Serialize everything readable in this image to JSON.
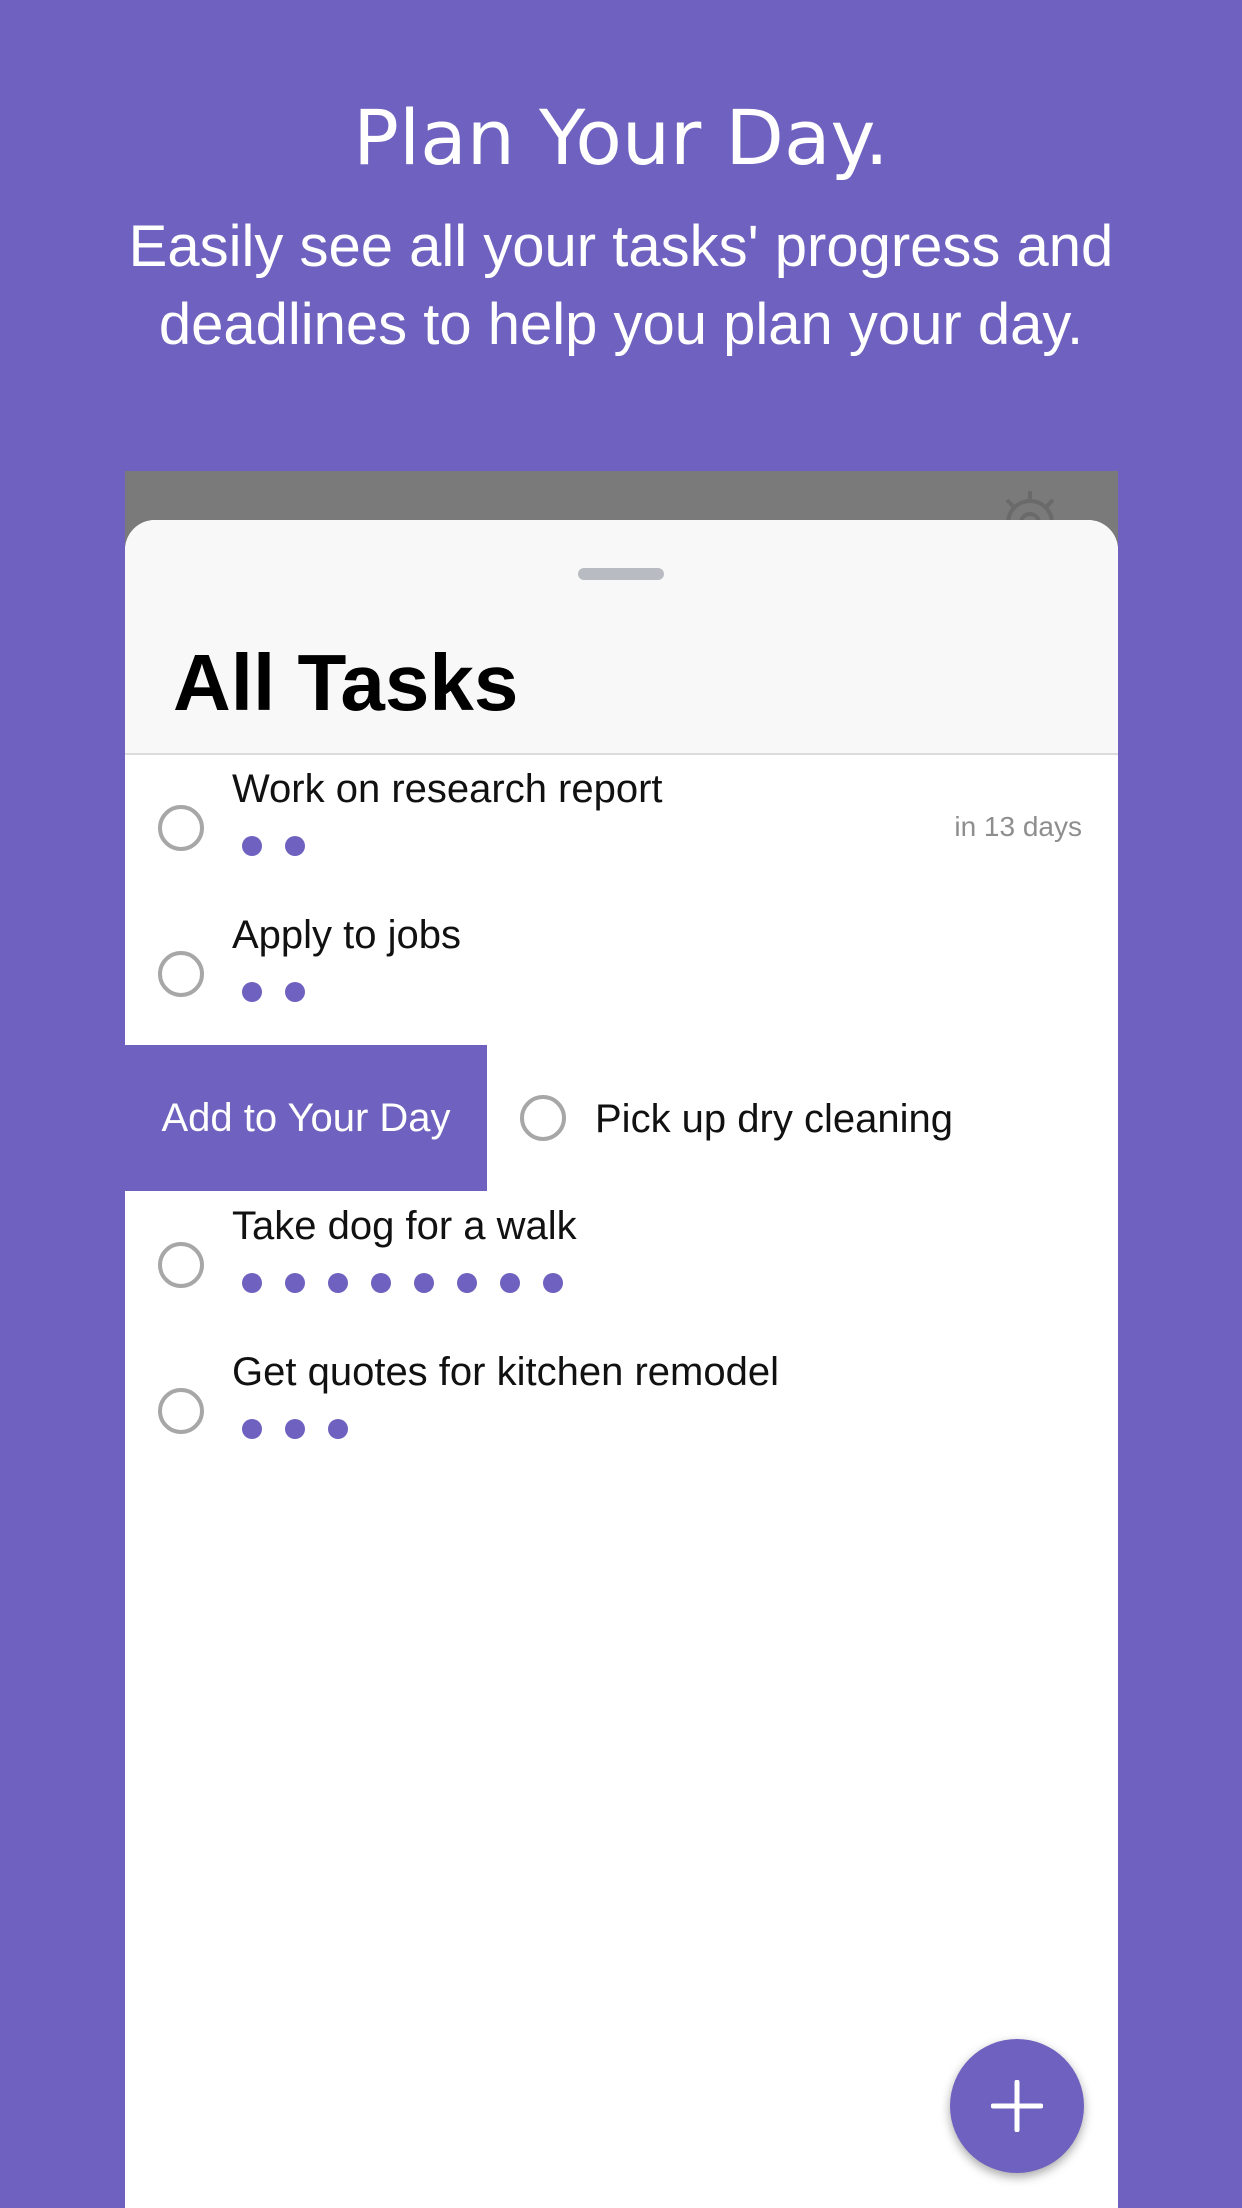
{
  "hero": {
    "title": "Plan Your Day.",
    "subtitle_line1": "Easily see all your tasks' progress and",
    "subtitle_line2": "deadlines to help you plan your day."
  },
  "sheet": {
    "title": "All Tasks"
  },
  "tasks": [
    {
      "title": "Work on research report",
      "dots": 2,
      "due": "in 13 days"
    },
    {
      "title": "Apply to jobs",
      "dots": 2
    },
    {
      "title": "Pick up dry cleaning",
      "swipe_action": "Add to Your Day",
      "dots": 0
    },
    {
      "title": "Take dog for a walk",
      "dots": 8
    },
    {
      "title": "Get quotes for kitchen remodel",
      "dots": 3
    }
  ],
  "icons": {
    "settings": "gear-icon",
    "add": "plus-icon",
    "task_checkbox": "circle-outline-icon"
  },
  "colors": {
    "accent": "#6f61bf",
    "background": "#6f61bf",
    "due_text": "#8e8e8e",
    "checkbox_border": "#a7a7a7"
  }
}
